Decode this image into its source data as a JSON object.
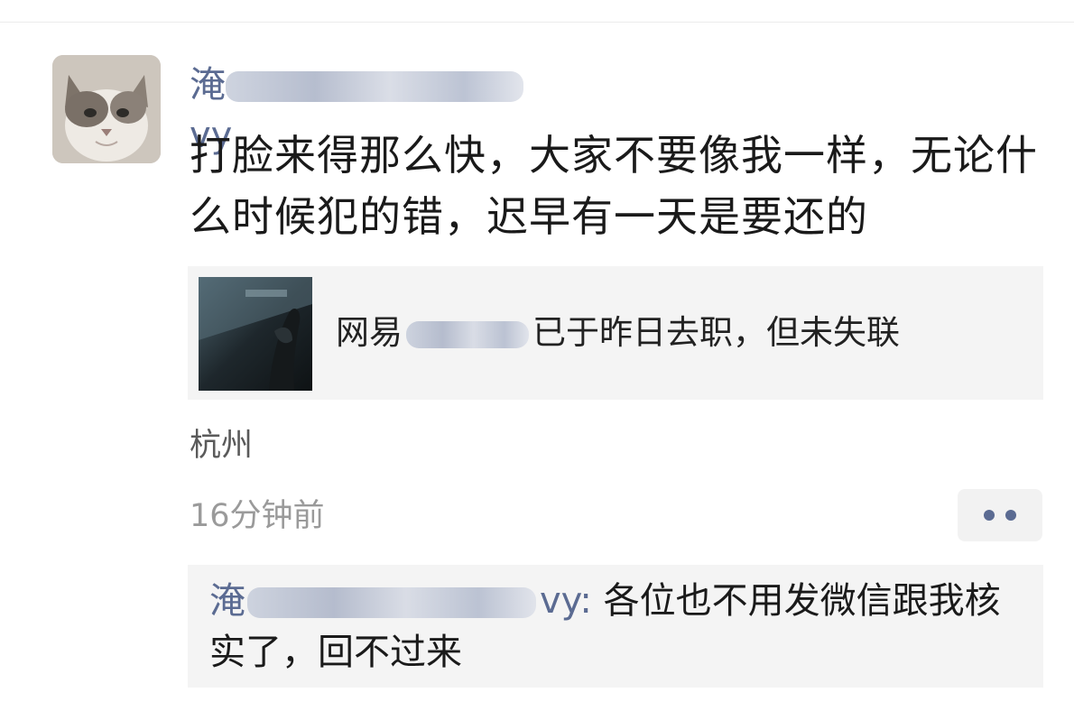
{
  "post": {
    "author": {
      "visible_prefix": "淹",
      "visible_suffix": "vy"
    },
    "text": "打脸来得那么快，大家不要像我一样，无论什么时候犯的错，迟早有一天是要还的",
    "link": {
      "title_prefix": "网易",
      "title_suffix": "已于昨日去职，但未失联"
    },
    "location": "杭州",
    "time": "16分钟前"
  },
  "comment": {
    "author_prefix": "淹",
    "author_suffix": "vy:",
    "text": " 各位也不用发微信跟我核实了，回不过来"
  },
  "icons": {
    "more": "more-dots-icon",
    "avatar": "cat-avatar",
    "thumbnail": "link-thumbnail-image"
  },
  "colors": {
    "link_blue": "#5b6b92",
    "card_bg": "#f4f4f4",
    "secondary_text": "#9a9a9a"
  }
}
